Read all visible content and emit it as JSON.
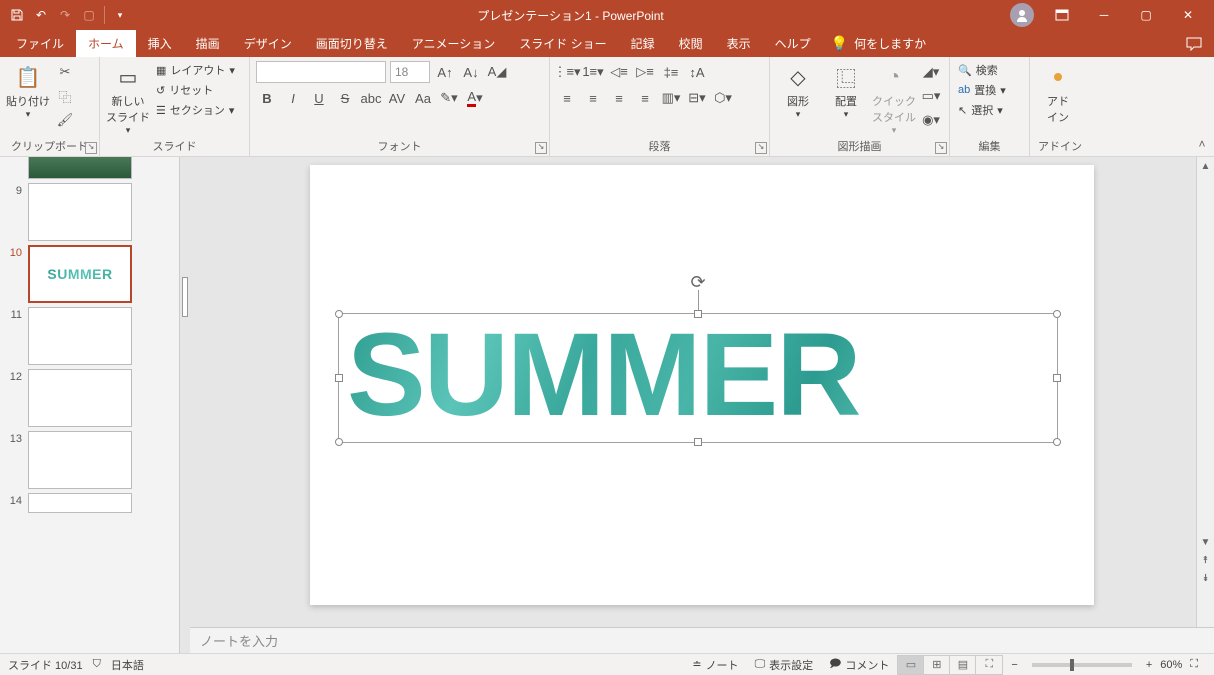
{
  "title": "プレゼンテーション1 - PowerPoint",
  "tabs": {
    "file": "ファイル",
    "home": "ホーム",
    "insert": "挿入",
    "draw": "描画",
    "design": "デザイン",
    "transitions": "画面切り替え",
    "animations": "アニメーション",
    "slideshow": "スライド ショー",
    "record": "記録",
    "review": "校閲",
    "view": "表示",
    "help": "ヘルプ",
    "tellme": "何をしますか"
  },
  "ribbon": {
    "clipboard": {
      "paste": "貼り付け",
      "label": "クリップボード"
    },
    "slides": {
      "new": "新しい\nスライド",
      "layout": "レイアウト",
      "reset": "リセット",
      "section": "セクション",
      "label": "スライド"
    },
    "font": {
      "size": "18",
      "label": "フォント"
    },
    "paragraph": {
      "label": "段落"
    },
    "drawing": {
      "shapes": "図形",
      "arrange": "配置",
      "quick": "クイック\nスタイル",
      "label": "図形描画"
    },
    "editing": {
      "find": "検索",
      "replace": "置換",
      "select": "選択",
      "label": "編集"
    },
    "addins": {
      "addin": "アド\nイン",
      "label": "アドイン"
    }
  },
  "slide_text": "SUMMER",
  "thumbnails": [
    "9",
    "10",
    "11",
    "12",
    "13",
    "14"
  ],
  "notes_placeholder": "ノートを入力",
  "status": {
    "slide": "スライド 10/31",
    "lang": "日本語",
    "notes": "ノート",
    "display": "表示設定",
    "comments": "コメント",
    "zoom": "60%"
  }
}
